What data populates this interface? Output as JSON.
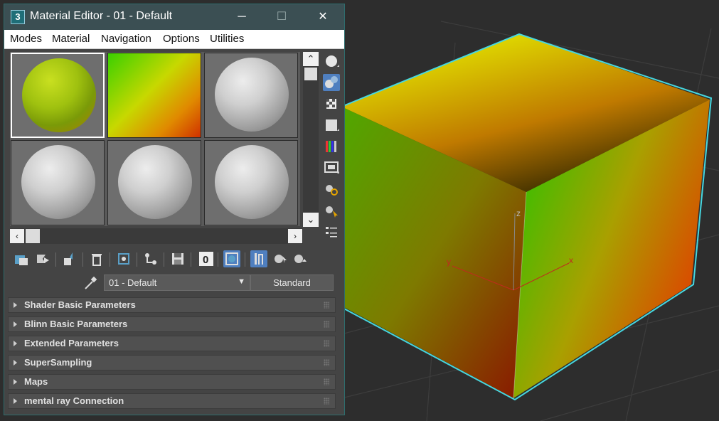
{
  "window": {
    "title": "Material Editor - 01 - Default",
    "app_icon_label": "3",
    "minimize_icon": "─",
    "maximize_icon": "☐",
    "close_icon": "✕"
  },
  "menu": [
    "Modes",
    "Material",
    "Navigation",
    "Options",
    "Utilities"
  ],
  "slots": [
    "gradient-sphere-selected",
    "gradient-box",
    "gray-sphere",
    "gray-sphere",
    "gray-sphere",
    "gray-sphere"
  ],
  "material": {
    "name": "01 - Default",
    "type": "Standard"
  },
  "rollouts": [
    "Shader Basic Parameters",
    "Blinn Basic Parameters",
    "Extended Parameters",
    "SuperSampling",
    "Maps",
    "mental ray Connection"
  ],
  "viewport": {
    "axis_x": "x",
    "axis_y": "y",
    "axis_z": "z",
    "selection_color": "#46d7e0"
  },
  "colors": {
    "accent": "#4f7fbf",
    "titlebar": "#3b4f53",
    "panel": "#444444"
  }
}
